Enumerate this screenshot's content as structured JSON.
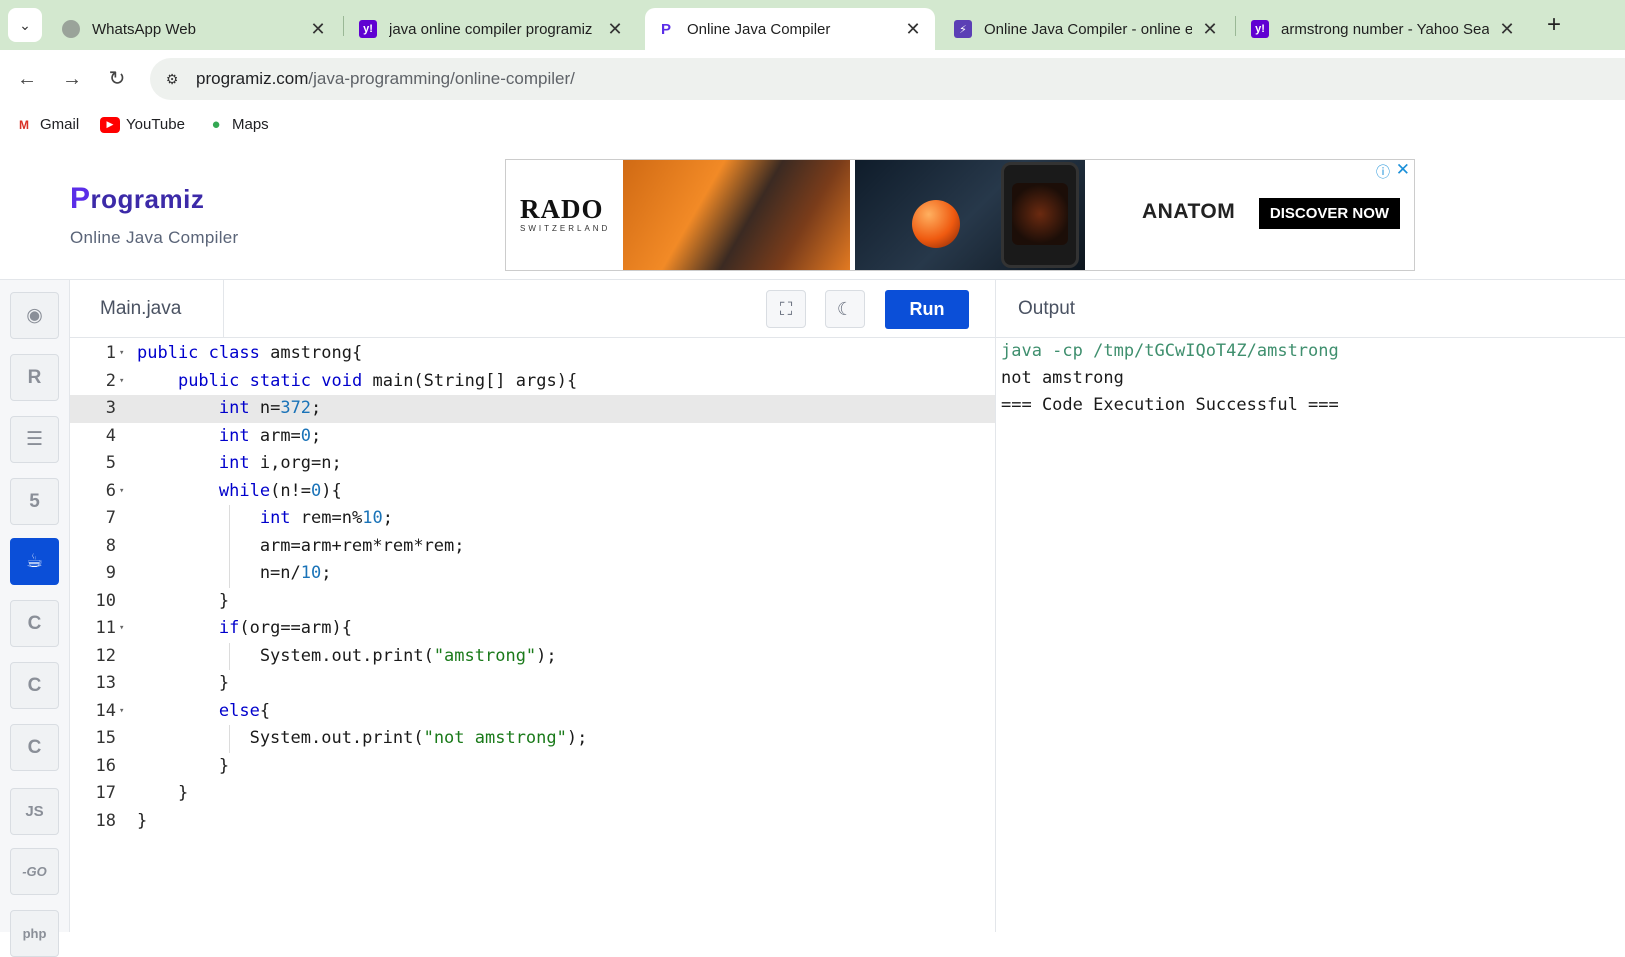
{
  "browser": {
    "tabs": [
      {
        "title": "WhatsApp Web",
        "favicon": "whatsapp-icon",
        "active": false
      },
      {
        "title": "java online compiler programiz",
        "favicon": "yahoo-icon",
        "active": false
      },
      {
        "title": "Online Java Compiler",
        "favicon": "programiz-icon",
        "active": true
      },
      {
        "title": "Online Java Compiler - online e",
        "favicon": "bolt-icon",
        "active": false
      },
      {
        "title": "armstrong number - Yahoo Sea",
        "favicon": "yahoo-icon",
        "active": false
      }
    ],
    "url_host": "programiz.com",
    "url_path": "/java-programming/online-compiler/",
    "bookmarks": [
      {
        "label": "Gmail",
        "icon": "gmail-icon"
      },
      {
        "label": "YouTube",
        "icon": "youtube-icon"
      },
      {
        "label": "Maps",
        "icon": "maps-icon"
      }
    ]
  },
  "site": {
    "logo_first": "P",
    "logo_rest": "rogramiz",
    "subtitle": "Online Java Compiler"
  },
  "ad": {
    "brand": "RADO",
    "brand_sub": "SWITZERLAND",
    "product": "ANATOM",
    "cta": "DISCOVER NOW"
  },
  "rail": [
    {
      "name": "python",
      "icon": "python-icon"
    },
    {
      "name": "r",
      "icon": "r-icon"
    },
    {
      "name": "sql",
      "icon": "database-icon"
    },
    {
      "name": "html",
      "icon": "html5-icon"
    },
    {
      "name": "java",
      "icon": "java-icon",
      "active": true
    },
    {
      "name": "c",
      "icon": "c-icon"
    },
    {
      "name": "cpp",
      "icon": "cpp-icon"
    },
    {
      "name": "csharp",
      "icon": "csharp-icon"
    },
    {
      "name": "js",
      "icon": "js-icon",
      "label": "JS"
    },
    {
      "name": "go",
      "icon": "go-icon",
      "label": "-GO"
    },
    {
      "name": "php",
      "icon": "php-icon",
      "label": "php"
    }
  ],
  "editor": {
    "filename": "Main.java",
    "run_label": "Run",
    "current_line": 3,
    "lines": [
      "public class amstrong{",
      "    public static void main(String[] args){",
      "        int n=372;",
      "        int arm=0;",
      "        int i,org=n;",
      "        while(n!=0){",
      "            int rem=n%10;",
      "            arm=arm+rem*rem*rem;",
      "            n=n/10;",
      "        }",
      "        if(org==arm){",
      "            System.out.print(\"amstrong\");",
      "        }",
      "        else{",
      "           System.out.print(\"not amstrong\");",
      "        }",
      "    }",
      "}"
    ],
    "foldable": [
      1,
      2,
      6,
      11,
      14
    ]
  },
  "output": {
    "title": "Output",
    "lines": [
      "java -cp /tmp/tGCwIQoT4Z/amstrong",
      "not amstrong",
      "=== Code Execution Successful ==="
    ]
  },
  "colors": {
    "tabstrip": "#d3e8cf",
    "accent": "#0b4fd8",
    "keyword": "#0000cc",
    "string": "#1a7a1a",
    "number": "#1a73b8"
  }
}
